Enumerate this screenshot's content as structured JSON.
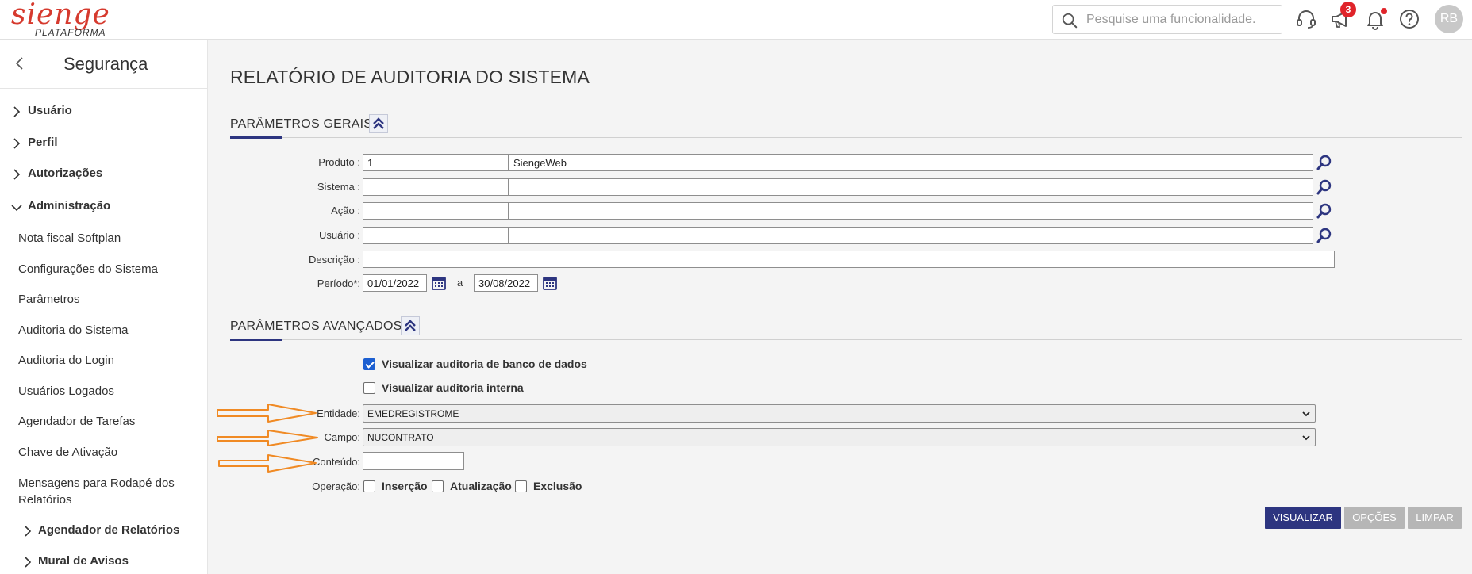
{
  "header": {
    "logo_text": "sienge",
    "logo_sub": "PLATAFORMA",
    "search_placeholder": "Pesquise uma funcionalidade.",
    "notification_count": "3",
    "avatar_initials": "RB",
    "brand_color": "#d63a2e",
    "badge_color": "#e0242a"
  },
  "sidebar": {
    "title": "Segurança",
    "groups": [
      {
        "label": "Usuário",
        "expanded": false
      },
      {
        "label": "Perfil",
        "expanded": false
      },
      {
        "label": "Autorizações",
        "expanded": false
      },
      {
        "label": "Administração",
        "expanded": true
      }
    ],
    "sub_items": [
      "Nota fiscal Softplan",
      "Configurações do Sistema",
      "Parâmetros",
      "Auditoria do Sistema",
      "Auditoria do Login",
      "Usuários Logados",
      "Agendador de Tarefas",
      "Chave de Ativação",
      "Mensagens para Rodapé dos Relatórios"
    ],
    "sub_groups": [
      {
        "label": "Agendador de Relatórios",
        "expanded": false
      },
      {
        "label": "Mural de Avisos",
        "expanded": false
      }
    ]
  },
  "main": {
    "page_title": "RELATÓRIO DE AUDITORIA DO SISTEMA",
    "general": {
      "title": "PARÂMETROS GERAIS",
      "produto_label": "Produto :",
      "produto_code": "1",
      "produto_name": "SiengeWeb",
      "sistema_label": "Sistema :",
      "acao_label": "Ação :",
      "usuario_label": "Usuário :",
      "descricao_label": "Descrição :",
      "periodo_label": "Período*:",
      "periodo_inicio": "01/01/2022",
      "periodo_sep": "a",
      "periodo_fim": "30/08/2022"
    },
    "advanced": {
      "title": "PARÂMETROS AVANÇADOS",
      "chk_banco_label": "Visualizar auditoria de banco de dados",
      "chk_banco_checked": true,
      "chk_interna_label": "Visualizar auditoria interna",
      "chk_interna_checked": false,
      "entidade_label": "Entidade:",
      "entidade_value": "EMEDREGISTROME",
      "campo_label": "Campo:",
      "campo_value": "NUCONTRATO",
      "conteudo_label": "Conteúdo:",
      "conteudo_value": "",
      "operacao_label": "Operação:",
      "op_insercao": "Inserção",
      "op_atualizacao": "Atualização",
      "op_exclusao": "Exclusão"
    },
    "buttons": {
      "visualizar": "VISUALIZAR",
      "opcoes": "OPÇÕES",
      "limpar": "LIMPAR"
    },
    "accent_color": "#2d3580",
    "annotation_arrow_color": "#f08a24"
  }
}
